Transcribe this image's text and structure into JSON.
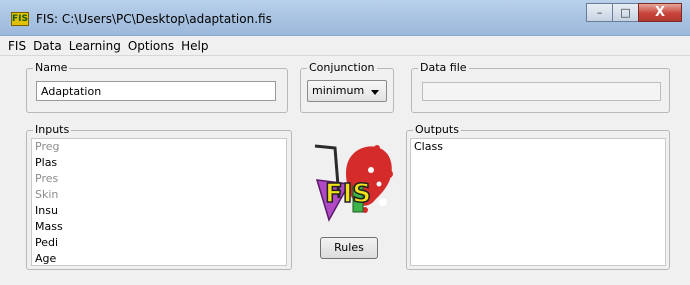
{
  "window": {
    "title": "FIS: C:\\Users\\PC\\Desktop\\adaptation.fis",
    "icon_text": "FIS",
    "minimize_glyph": "–",
    "maximize_glyph": "□",
    "close_glyph": "X"
  },
  "menu": [
    "FIS",
    "Data",
    "Learning",
    "Options",
    "Help"
  ],
  "name_group": {
    "label": "Name",
    "value": "Adaptation"
  },
  "conjunction_group": {
    "label": "Conjunction",
    "selected": "minimum"
  },
  "datafile_group": {
    "label": "Data file",
    "value": ""
  },
  "inputs_group": {
    "label": "Inputs",
    "items": [
      {
        "label": "Preg",
        "dimmed": true
      },
      {
        "label": "Plas",
        "dimmed": false
      },
      {
        "label": "Pres",
        "dimmed": true
      },
      {
        "label": "Skin",
        "dimmed": true
      },
      {
        "label": "Insu",
        "dimmed": false
      },
      {
        "label": "Mass",
        "dimmed": false
      },
      {
        "label": "Pedi",
        "dimmed": false
      },
      {
        "label": "Age",
        "dimmed": false
      }
    ]
  },
  "outputs_group": {
    "label": "Outputs",
    "items": [
      "Class"
    ]
  },
  "logo_text": "FIS",
  "rules_button": "Rules"
}
